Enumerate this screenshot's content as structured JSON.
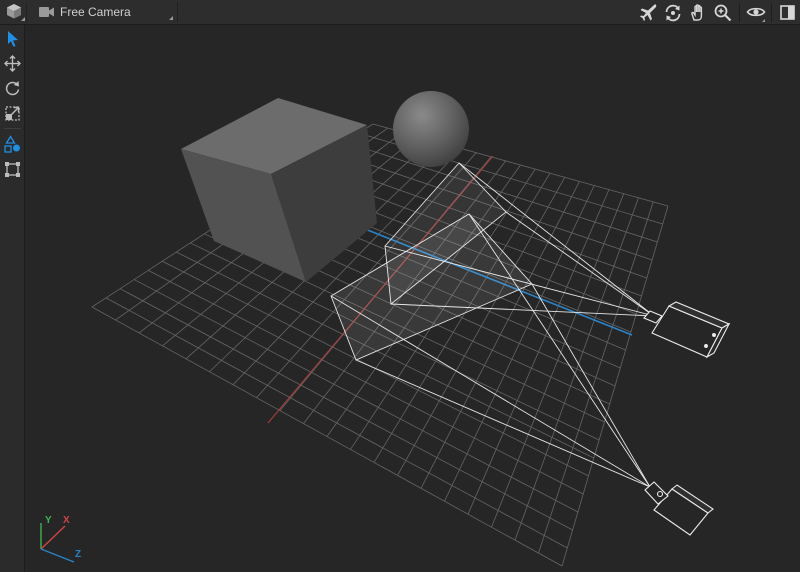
{
  "toolbar": {
    "camera_label": "Free Camera",
    "icons": [
      "cube-icon",
      "video-camera-icon",
      "airplane-icon",
      "orbit-icon",
      "hand-pan-icon",
      "zoom-icon",
      "eye-icon",
      "panel-toggle-icon"
    ]
  },
  "sidebar": {
    "tools": [
      "select-arrow-icon",
      "move-icon",
      "rotate-icon",
      "scale-icon",
      "shapes-icon",
      "bounding-box-icon"
    ],
    "active_tool": "select-arrow-icon"
  },
  "viewport": {
    "objects": [
      "cube",
      "sphere",
      "camera-1",
      "camera-2",
      "grid"
    ]
  },
  "axis_gizmo": {
    "y_label": "Y",
    "x_label": "X",
    "z_label": "Z"
  },
  "colors": {
    "accent": "#1e90e6",
    "x_axis": "#d24545",
    "y_axis": "#3fb34f",
    "z_axis": "#2a83c7",
    "background": "#262626"
  }
}
